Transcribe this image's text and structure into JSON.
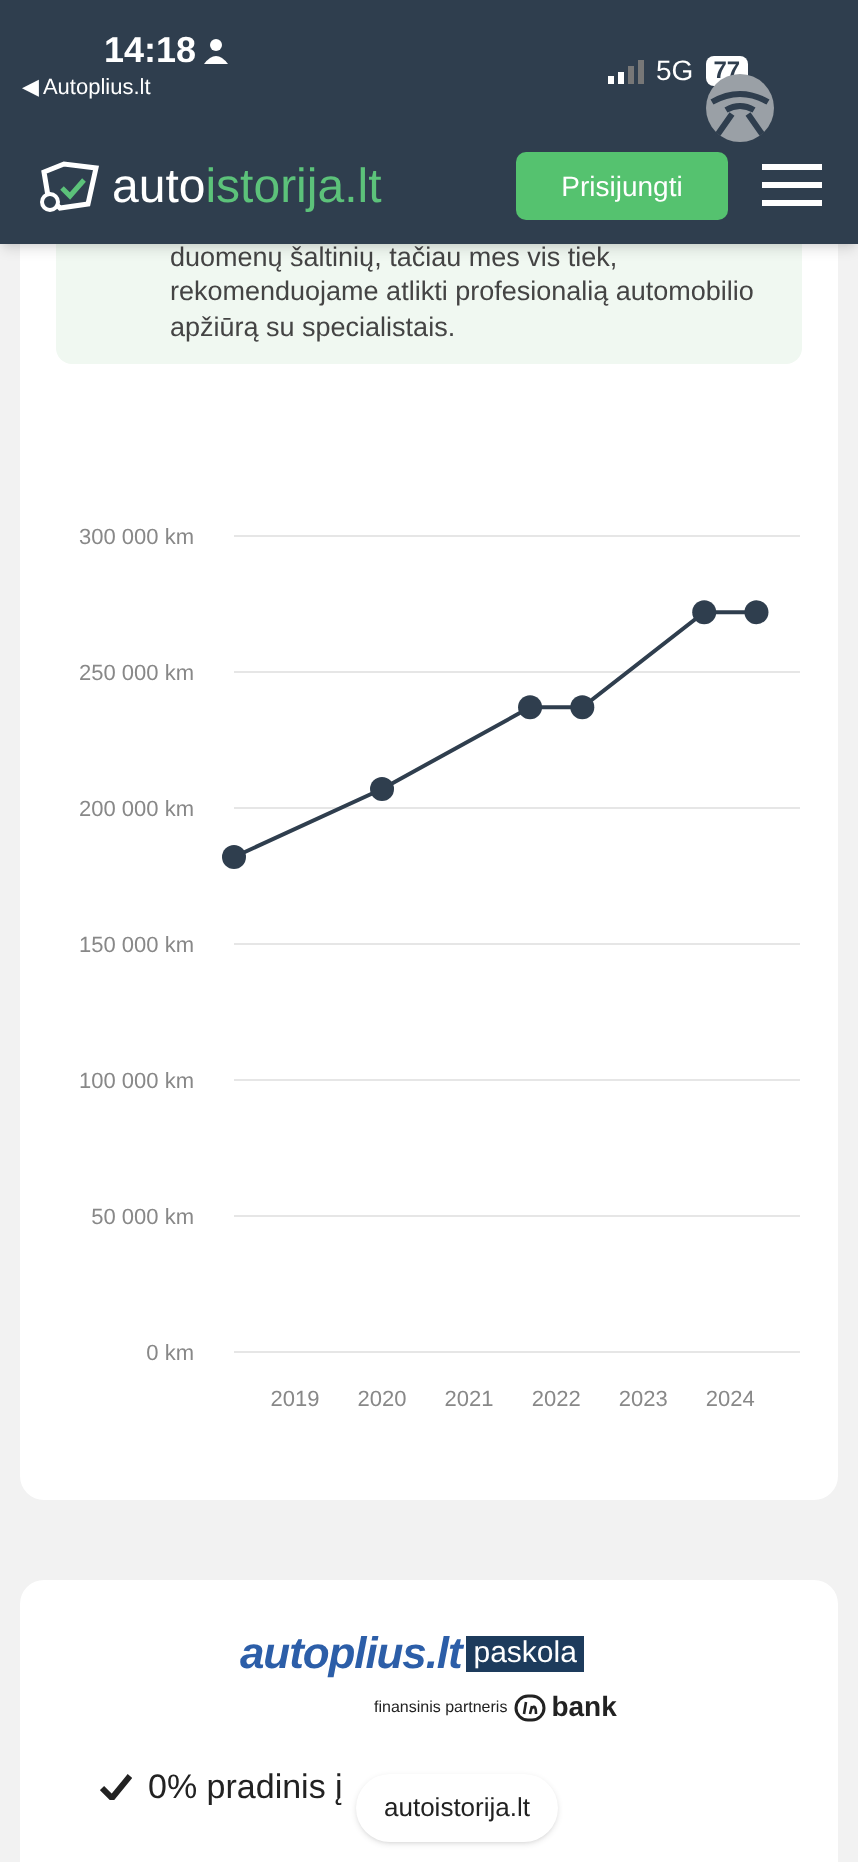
{
  "status_bar": {
    "time": "14:18",
    "back_label": "◀ Autoplius.lt",
    "network": "5G",
    "battery": "77"
  },
  "header": {
    "logo_prefix": "auto",
    "logo_suffix": "istorija.lt",
    "login_button": "Prisijungti"
  },
  "notice": {
    "text": "duomenų šaltinių, tačiau mes vis tiek, rekomenduojame atlikti profesionalią automobilio apžiūrą su specialistais."
  },
  "mileage_chart": {
    "chart_data": {
      "type": "line",
      "x": [
        2018.3,
        2020.0,
        2021.7,
        2022.3,
        2023.7,
        2024.3
      ],
      "grid": true,
      "series": [
        {
          "color": "#2f3e4e",
          "marker": "circle",
          "values": [
            182000,
            207000,
            237000,
            237000,
            272000,
            272000
          ]
        }
      ],
      "xlim": [
        2018.3,
        2024.8
      ],
      "ylim": [
        0,
        300000
      ],
      "xticks": [
        {
          "value": 2019,
          "label": "2019"
        },
        {
          "value": 2020,
          "label": "2020"
        },
        {
          "value": 2021,
          "label": "2021"
        },
        {
          "value": 2022,
          "label": "2022"
        },
        {
          "value": 2023,
          "label": "2023"
        },
        {
          "value": 2024,
          "label": "2024"
        }
      ],
      "yticks": [
        {
          "value": 0,
          "label": "0 km"
        },
        {
          "value": 50000,
          "label": "50 000 km"
        },
        {
          "value": 100000,
          "label": "100 000 km"
        },
        {
          "value": 150000,
          "label": "150 000 km"
        },
        {
          "value": 200000,
          "label": "200 000 km"
        },
        {
          "value": 250000,
          "label": "250 000 km"
        },
        {
          "value": 300000,
          "label": "300 000 km"
        }
      ]
    }
  },
  "loan_card": {
    "logo_main": "autoplius.lt",
    "logo_tag": "paskola",
    "partner_label": "finansinis partneris",
    "partner_name": "bank",
    "benefits": [
      "0% pradinis į"
    ]
  },
  "site_pill": "autoistorija.lt"
}
